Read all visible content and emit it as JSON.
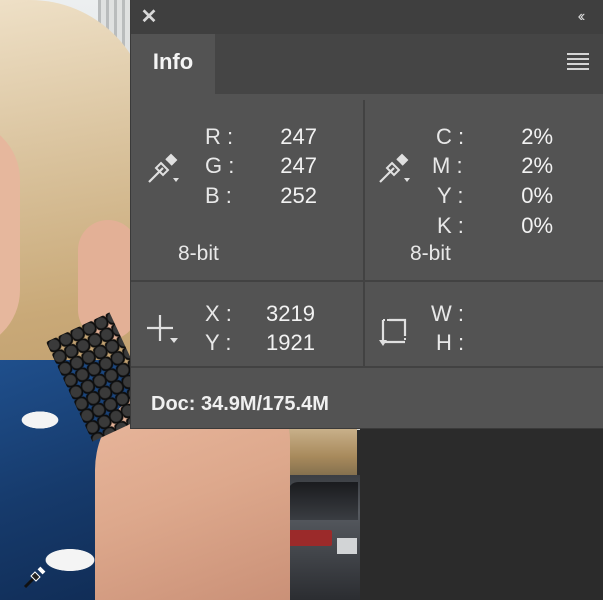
{
  "panel": {
    "close_icon": "close-icon",
    "collapse_icon": "double-chevron-left-icon",
    "menu_icon": "panel-menu-icon",
    "tab_label": "Info"
  },
  "rgb": {
    "labels": [
      "R :",
      "G :",
      "B :"
    ],
    "values": [
      "247",
      "247",
      "252"
    ],
    "bit_depth": "8-bit",
    "icon": "eyedropper-icon"
  },
  "cmyk": {
    "labels": [
      "C :",
      "M :",
      "Y :",
      "K :"
    ],
    "values": [
      "2%",
      "2%",
      "0%",
      "0%"
    ],
    "bit_depth": "8-bit",
    "icon": "eyedropper-icon"
  },
  "position": {
    "labels": [
      "X :",
      "Y :"
    ],
    "values": [
      "3219",
      "1921"
    ],
    "icon": "crosshair-icon"
  },
  "size": {
    "labels": [
      "W :",
      "H :"
    ],
    "icon": "selection-size-icon"
  },
  "doc": {
    "text": "Doc: 34.9M/175.4M"
  },
  "colors": {
    "panel_bg": "#535353",
    "titlebar_bg": "#3f3f3f",
    "tabrow_bg": "#454545",
    "text": "#e8e8e8"
  }
}
